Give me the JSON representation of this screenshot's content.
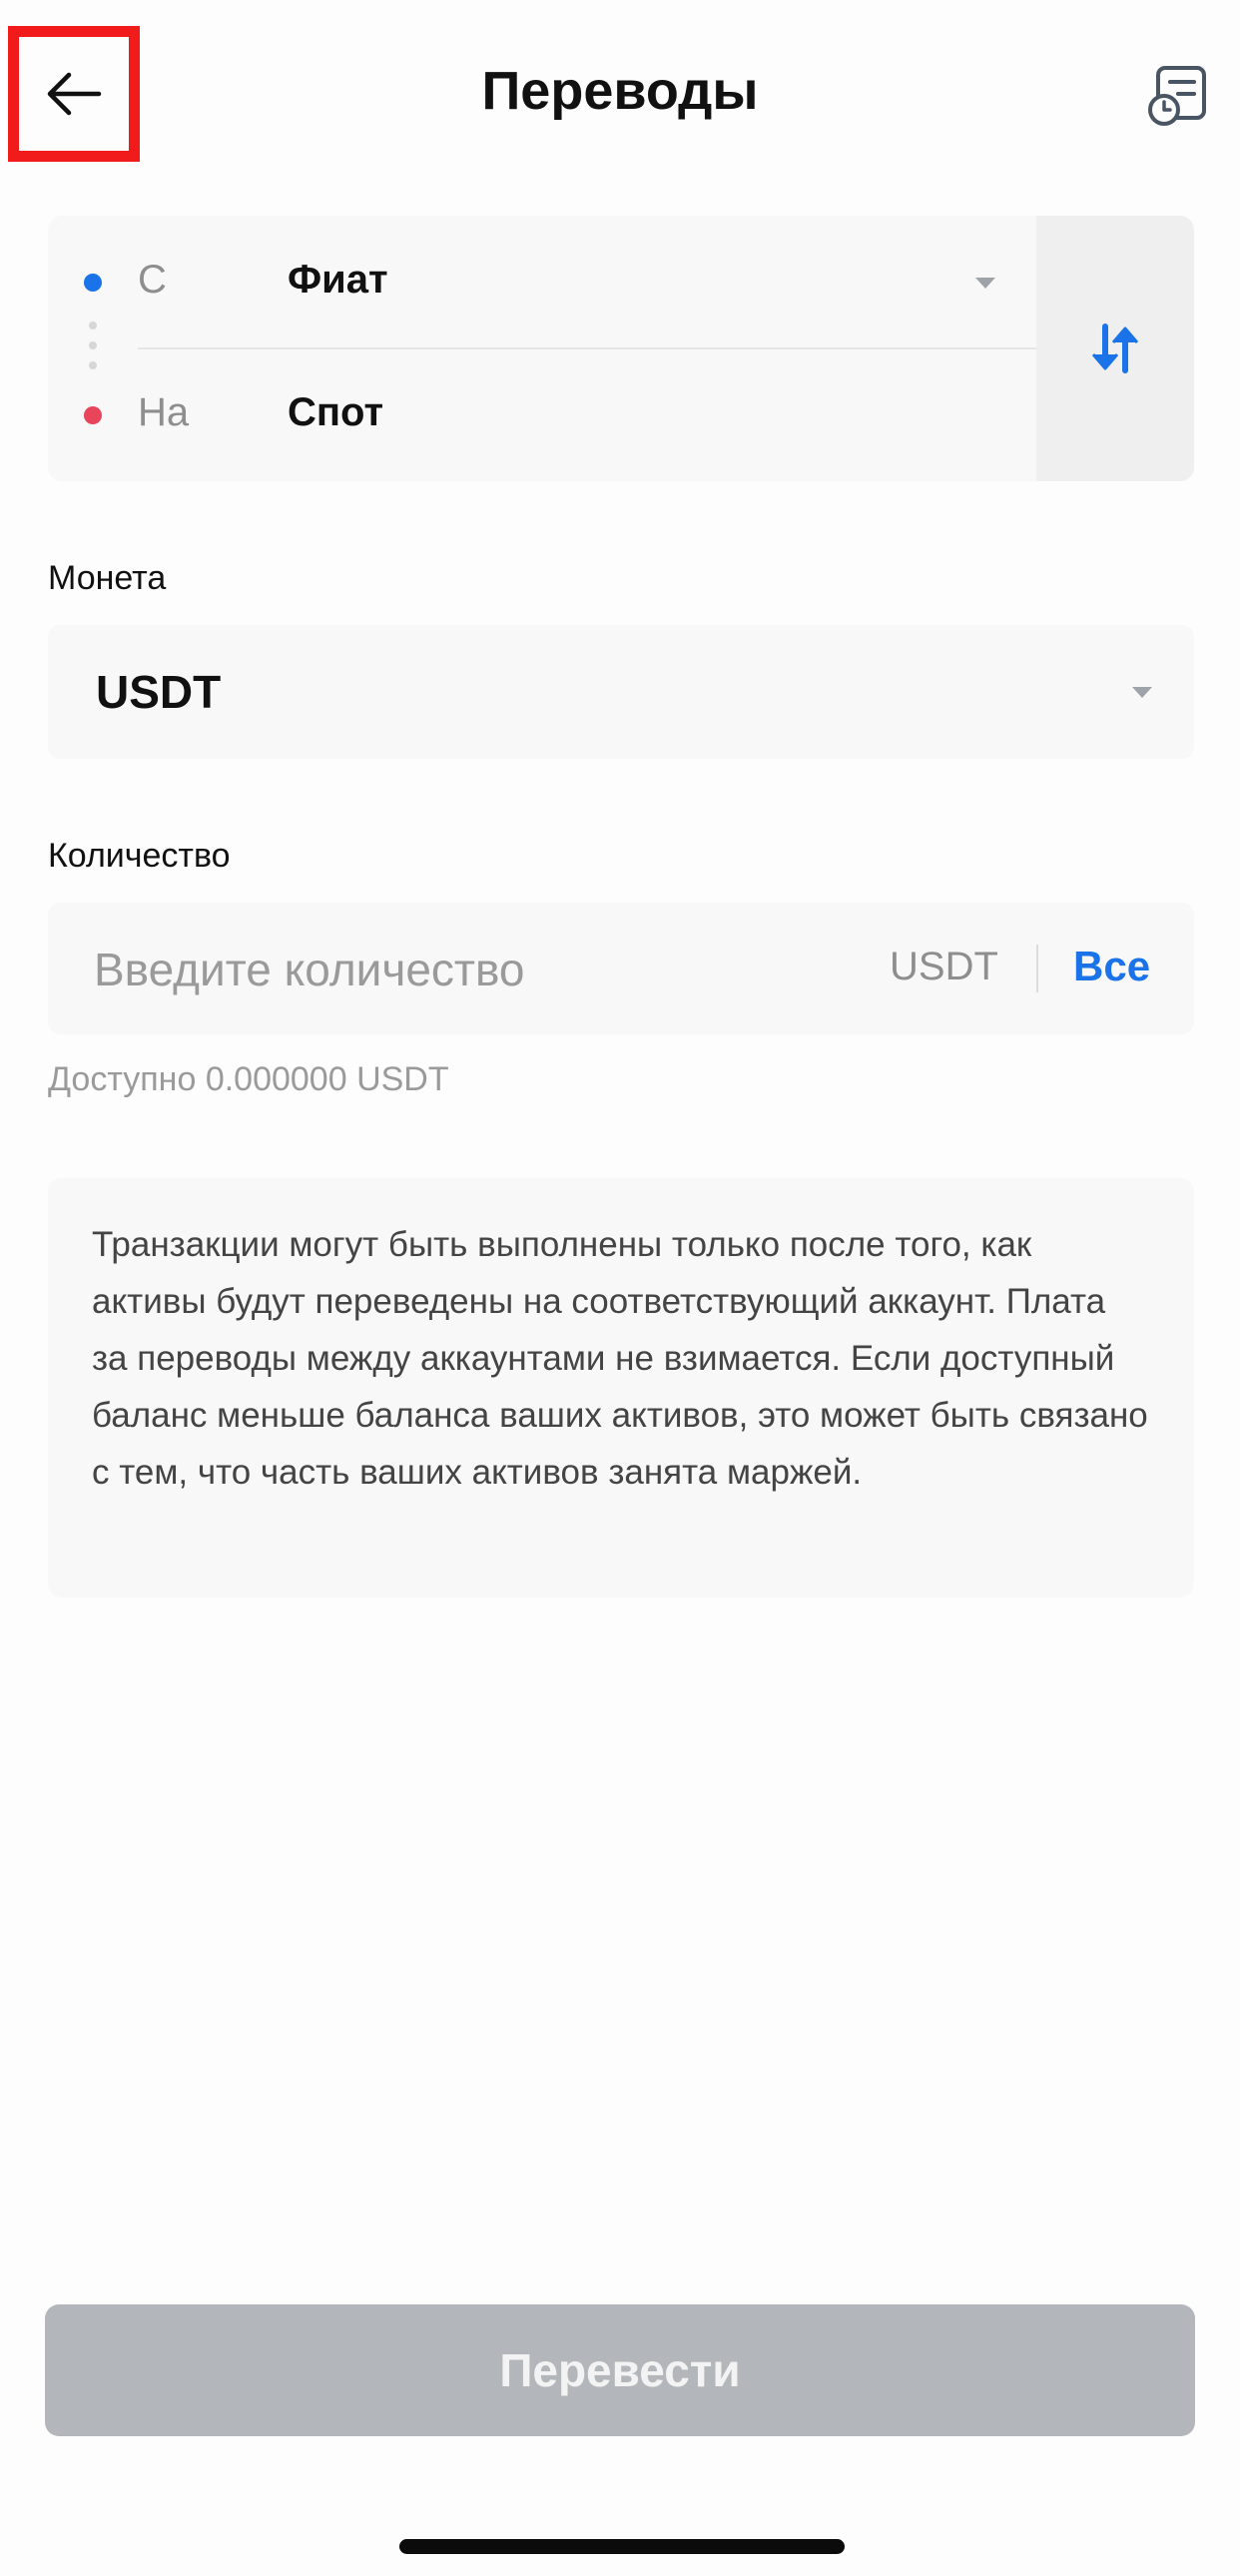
{
  "header": {
    "title": "Переводы",
    "back_icon": "arrow-left-icon",
    "history_icon": "transfer-history-icon"
  },
  "transfer": {
    "from_label": "С",
    "from_value": "Фиат",
    "to_label": "На",
    "to_value": "Спот",
    "swap_icon": "swap-arrows-icon"
  },
  "coin": {
    "label": "Монета",
    "value": "USDT"
  },
  "amount": {
    "label": "Количество",
    "placeholder": "Введите количество",
    "value": "",
    "unit": "USDT",
    "all_label": "Все"
  },
  "available": {
    "text": "Доступно 0.000000 USDT"
  },
  "info": {
    "text": "Транзакции могут быть выполнены только после того, как активы будут переведены на соответствующий аккаунт. Плата за переводы между аккаунтами не взимается. Если доступный баланс меньше баланса ваших активов, это может быть связано с тем, что часть ваших активов занята маржей."
  },
  "submit": {
    "label": "Перевести"
  },
  "colors": {
    "accent": "#1a73e8",
    "from_dot": "#1a73e8",
    "to_dot": "#e8445a",
    "highlight": "#f21b1b",
    "button_disabled": "#b3b6ba"
  }
}
